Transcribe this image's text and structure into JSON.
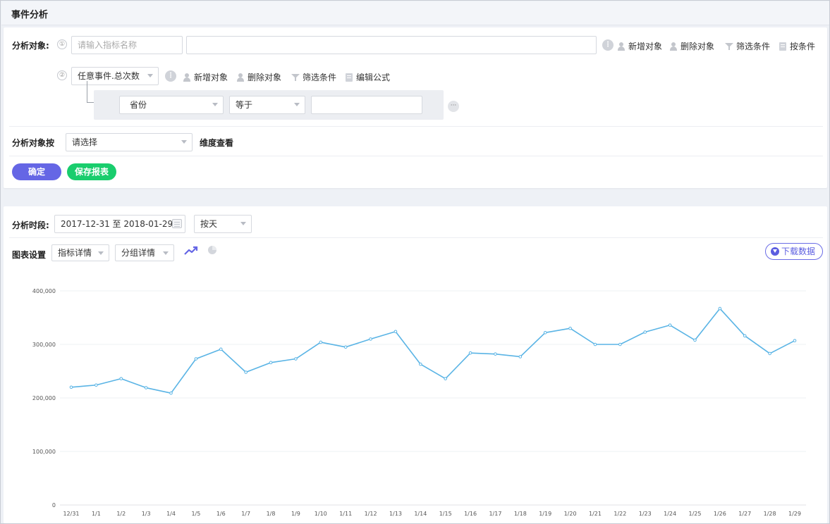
{
  "header": {
    "title": "事件分析"
  },
  "query": {
    "subject_label": "分析对象:",
    "metric1": {
      "num": "①",
      "name_placeholder": "请输入指标名称",
      "formula_value": "",
      "actions": [
        "新增对象",
        "删除对象",
        "筛选条件",
        "按条件"
      ]
    },
    "metric2": {
      "num": "②",
      "event_select": "任意事件.总次数",
      "actions": [
        "新增对象",
        "删除对象",
        "筛选条件",
        "编辑公式"
      ],
      "filter": {
        "field": "省份",
        "operator": "等于",
        "value": "",
        "more": "···"
      }
    },
    "group_by_label": "分析对象按",
    "group_by_select": "请选择",
    "group_by_suffix": "维度查看",
    "confirm_button": "确定",
    "save_button": "保存报表"
  },
  "result": {
    "period_label": "分析时段:",
    "date_range": "2017-12-31 至 2018-01-29",
    "granularity": "按天",
    "chart_settings_label": "图表设置",
    "metric_detail": "指标详情",
    "group_detail": "分组详情",
    "download_button": "下载数据"
  },
  "colors": {
    "primary": "#6566e5",
    "green": "#19cd6d",
    "line": "#5ab4e5"
  },
  "chart_data": {
    "type": "line",
    "categories": [
      "12/31",
      "1/1",
      "1/2",
      "1/3",
      "1/4",
      "1/5",
      "1/6",
      "1/7",
      "1/8",
      "1/9",
      "1/10",
      "1/11",
      "1/12",
      "1/13",
      "1/14",
      "1/15",
      "1/16",
      "1/17",
      "1/18",
      "1/19",
      "1/20",
      "1/21",
      "1/22",
      "1/23",
      "1/24",
      "1/25",
      "1/26",
      "1/27",
      "1/28",
      "1/29"
    ],
    "values": [
      220000,
      224000,
      236000,
      219000,
      209000,
      273000,
      291000,
      248000,
      266000,
      273000,
      304000,
      295000,
      310000,
      324000,
      263000,
      236000,
      284000,
      282000,
      277000,
      322000,
      330000,
      300000,
      300000,
      323000,
      336000,
      308000,
      367000,
      316000,
      283000,
      307000
    ],
    "yticks": [
      "0",
      "100,000",
      "200,000",
      "300,000",
      "400,000"
    ],
    "ylim": [
      0,
      400000
    ],
    "grid": true,
    "legend": "none"
  }
}
